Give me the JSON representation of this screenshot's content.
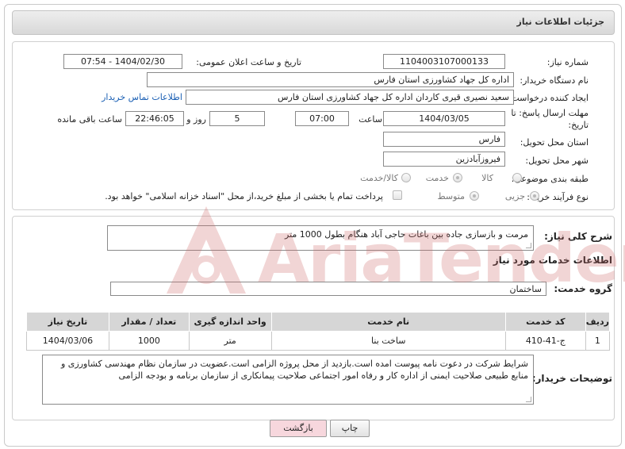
{
  "header": {
    "title": "جزئیات اطلاعات نیاز"
  },
  "form": {
    "need_number": {
      "label": "شماره نیاز:",
      "value": "1104003107000133"
    },
    "announce_datetime": {
      "label": "تاریخ و ساعت اعلان عمومی:",
      "value": "1404/02/30 - 07:54"
    },
    "buyer_org": {
      "label": "نام دستگاه خریدار:",
      "value": "اداره کل جهاد کشاورزی استان فارس"
    },
    "requester": {
      "label": "ایجاد کننده درخواست:",
      "value": "سعید نصیری قیری کاردان اداره کل جهاد کشاورزی استان فارس",
      "contact_link": "اطلاعات تماس خریدار"
    },
    "deadline": {
      "label_line1": "مهلت ارسال پاسخ: تا",
      "label_line2": "تاریخ:",
      "date": "1404/03/05",
      "time_label": "ساعت",
      "time": "07:00",
      "days": "5",
      "days_label": "روز و",
      "remaining_time": "22:46:05",
      "remaining_label": "ساعت باقی مانده"
    },
    "province": {
      "label": "استان محل تحویل:",
      "value": "فارس"
    },
    "city": {
      "label": "شهر محل تحویل:",
      "value": "فیروزآبادزین"
    },
    "category": {
      "label": "طبقه بندی موضوعی:",
      "options": [
        "کالا",
        "خدمت",
        "کالا/خدمت"
      ],
      "selected": "خدمت"
    },
    "process": {
      "label": "نوع فرآیند خرید :",
      "options": [
        "جزیی",
        "متوسط"
      ],
      "selected": "جزیی",
      "payment_note": "پرداخت تمام یا بخشی از مبلغ خرید،از محل \"اسناد خزانه اسلامی\" خواهد بود."
    }
  },
  "summary": {
    "label": "شرح کلی نیاز:",
    "value": "مرمت و بازسازی جاده بین باغات  حاجی آباد هنگام بطول  1000 متر"
  },
  "services": {
    "section_title": "اطلاعات خدمات مورد نیاز",
    "group_label": "گروه خدمت:",
    "group_value": "ساختمان",
    "columns": [
      "ردیف",
      "کد خدمت",
      "نام خدمت",
      "واحد اندازه گیری",
      "تعداد / مقدار",
      "تاریخ نیاز"
    ],
    "rows": [
      [
        "1",
        "ج-41-410",
        "ساخت بنا",
        "متر",
        "1000",
        "1404/03/06"
      ]
    ]
  },
  "buyer_notes": {
    "label": "توضیحات خریدار:",
    "value": "شرایط شرکت در دعوت نامه پیوست امده است.بازدید از  محل پروژه الزامی است.عضویت در سازمان نظام مهندسی کشاورزی و منابع طبیعی صلاحیت  ایمنی از اداره کار و رفاه امور اجتماعی صلاحیت پیمانکاری از سازمان برنامه و بودجه الزامی"
  },
  "buttons": {
    "print": "چاپ",
    "back": "بازگشت"
  },
  "watermark": {
    "text": "AriaTender.neT"
  },
  "colors": {
    "link": "#1a5fb4",
    "back_button_bg": "#f7d7dd",
    "watermark": "#e8a3a3"
  }
}
